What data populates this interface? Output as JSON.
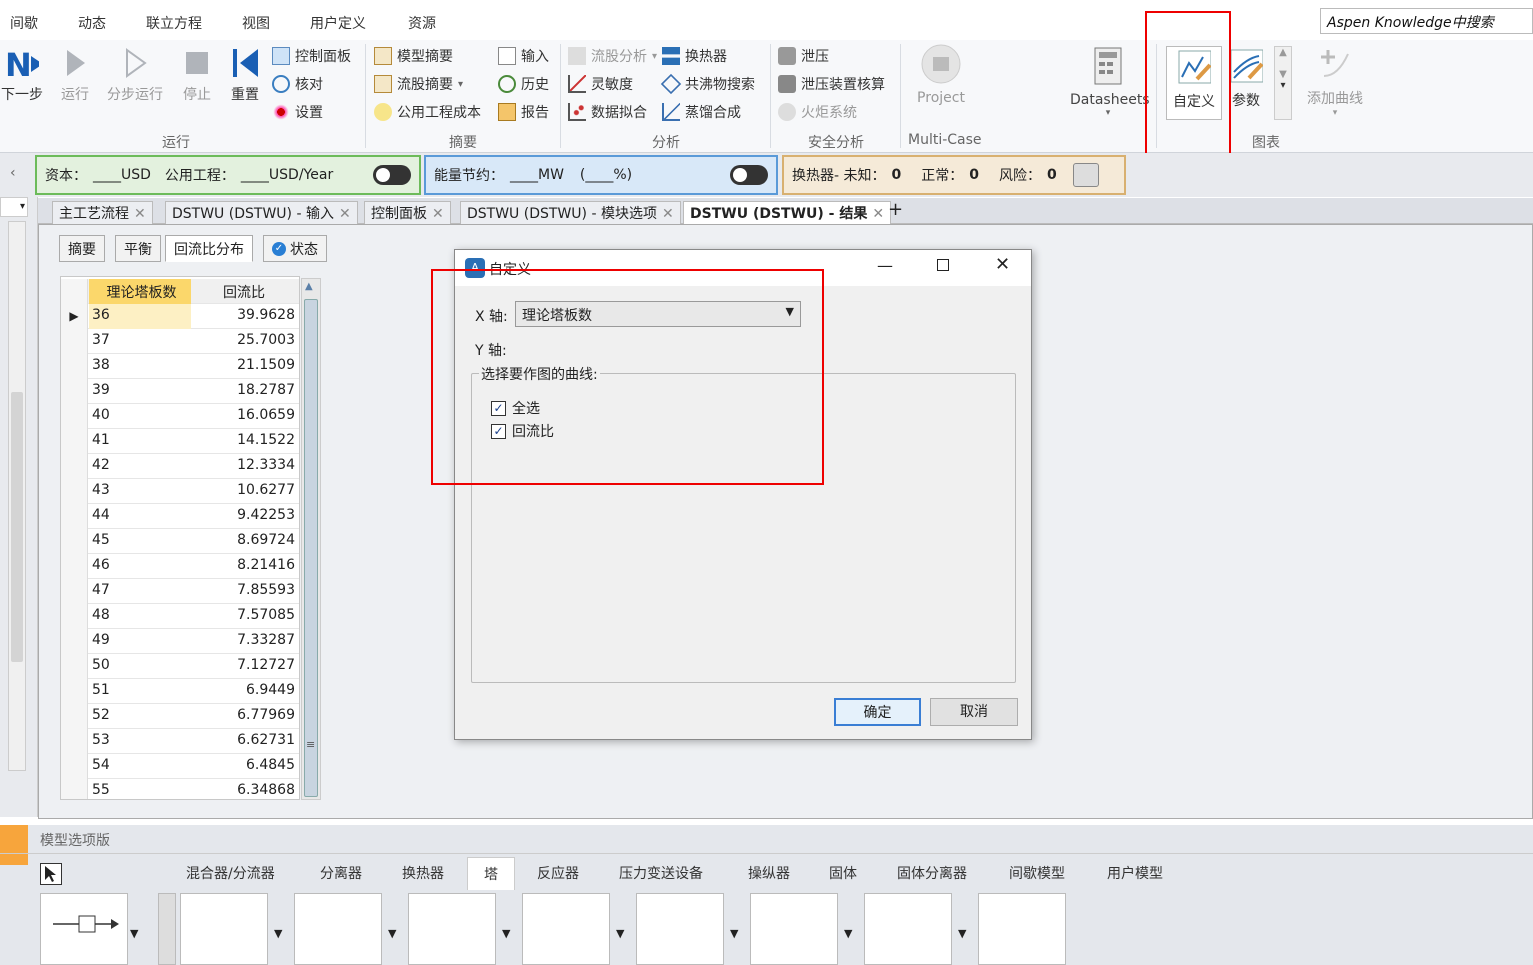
{
  "menubar": {
    "items": [
      "间歇",
      "动态",
      "联立方程",
      "视图",
      "用户定义",
      "资源"
    ],
    "search_placeholder": "Aspen Knowledge中搜索"
  },
  "ribbon": {
    "run_group": {
      "next": "下一步",
      "run": "运行",
      "step": "分步运行",
      "stop": "停止",
      "reset": "重置",
      "control_panel": "控制面板",
      "check": "核对",
      "settings": "设置",
      "label": "运行"
    },
    "summary_group": {
      "model_summary": "模型摘要",
      "stream_summary": "流股摘要",
      "utility_cost": "公用工程成本",
      "input": "输入",
      "history": "历史",
      "report": "报告",
      "label": "摘要"
    },
    "analysis_group": {
      "stream_analysis": "流股分析",
      "sensitivity": "灵敏度",
      "data_fit": "数据拟合",
      "heat_exchanger": "换热器",
      "azeotrope": "共沸物搜索",
      "distillation": "蒸馏合成",
      "label": "分析"
    },
    "safety_group": {
      "relief": "泄压",
      "relief_check": "泄压装置核算",
      "flare": "火炬系统",
      "label": "安全分析"
    },
    "multicase_group": {
      "project": "Project",
      "label": "Multi-Case"
    },
    "datasheets": "Datasheets",
    "chart_group": {
      "custom": "自定义",
      "param": "参数",
      "add_curve": "添加曲线",
      "label": "图表"
    }
  },
  "status_bars": {
    "capital": "资本：",
    "capital_unit": "____USD",
    "utility": "公用工程：",
    "utility_unit": "____USD/Year",
    "energy": "能量节约：",
    "energy_unit": "____MW",
    "energy_pct": "(____%)",
    "hx_label": "换热器- 未知：",
    "hx_unknown": "0",
    "normal_label": "正常：",
    "normal": "0",
    "risk_label": "风险：",
    "risk": "0"
  },
  "doc_tabs": [
    "主工艺流程",
    "DSTWU (DSTWU) - 输入",
    "控制面板",
    "DSTWU (DSTWU) - 模块选项",
    "DSTWU (DSTWU) - 结果"
  ],
  "sub_tabs": [
    "摘要",
    "平衡",
    "回流比分布",
    "状态"
  ],
  "table": {
    "headers": [
      "理论塔板数",
      "回流比"
    ],
    "rows": [
      [
        "36",
        "39.9628"
      ],
      [
        "37",
        "25.7003"
      ],
      [
        "38",
        "21.1509"
      ],
      [
        "39",
        "18.2787"
      ],
      [
        "40",
        "16.0659"
      ],
      [
        "41",
        "14.1522"
      ],
      [
        "42",
        "12.3334"
      ],
      [
        "43",
        "10.6277"
      ],
      [
        "44",
        "9.42253"
      ],
      [
        "45",
        "8.69724"
      ],
      [
        "46",
        "8.21416"
      ],
      [
        "47",
        "7.85593"
      ],
      [
        "48",
        "7.57085"
      ],
      [
        "49",
        "7.33287"
      ],
      [
        "50",
        "7.12727"
      ],
      [
        "51",
        "6.9449"
      ],
      [
        "52",
        "6.77969"
      ],
      [
        "53",
        "6.62731"
      ],
      [
        "54",
        "6.4845"
      ],
      [
        "55",
        "6.34868"
      ]
    ]
  },
  "dialog": {
    "title": "自定义",
    "x_label": "X 轴:",
    "x_value": "理论塔板数",
    "y_label": "Y 轴:",
    "group_label": "选择要作图的曲线:",
    "check_all": "全选",
    "check_reflux": "回流比",
    "ok": "确定",
    "cancel": "取消"
  },
  "palette": {
    "title": "模型选项版",
    "tabs": [
      "混合器/分流器",
      "分离器",
      "换热器",
      "塔",
      "反应器",
      "压力变送设备",
      "操纵器",
      "固体",
      "固体分离器",
      "间歇模型",
      "用户模型"
    ]
  }
}
